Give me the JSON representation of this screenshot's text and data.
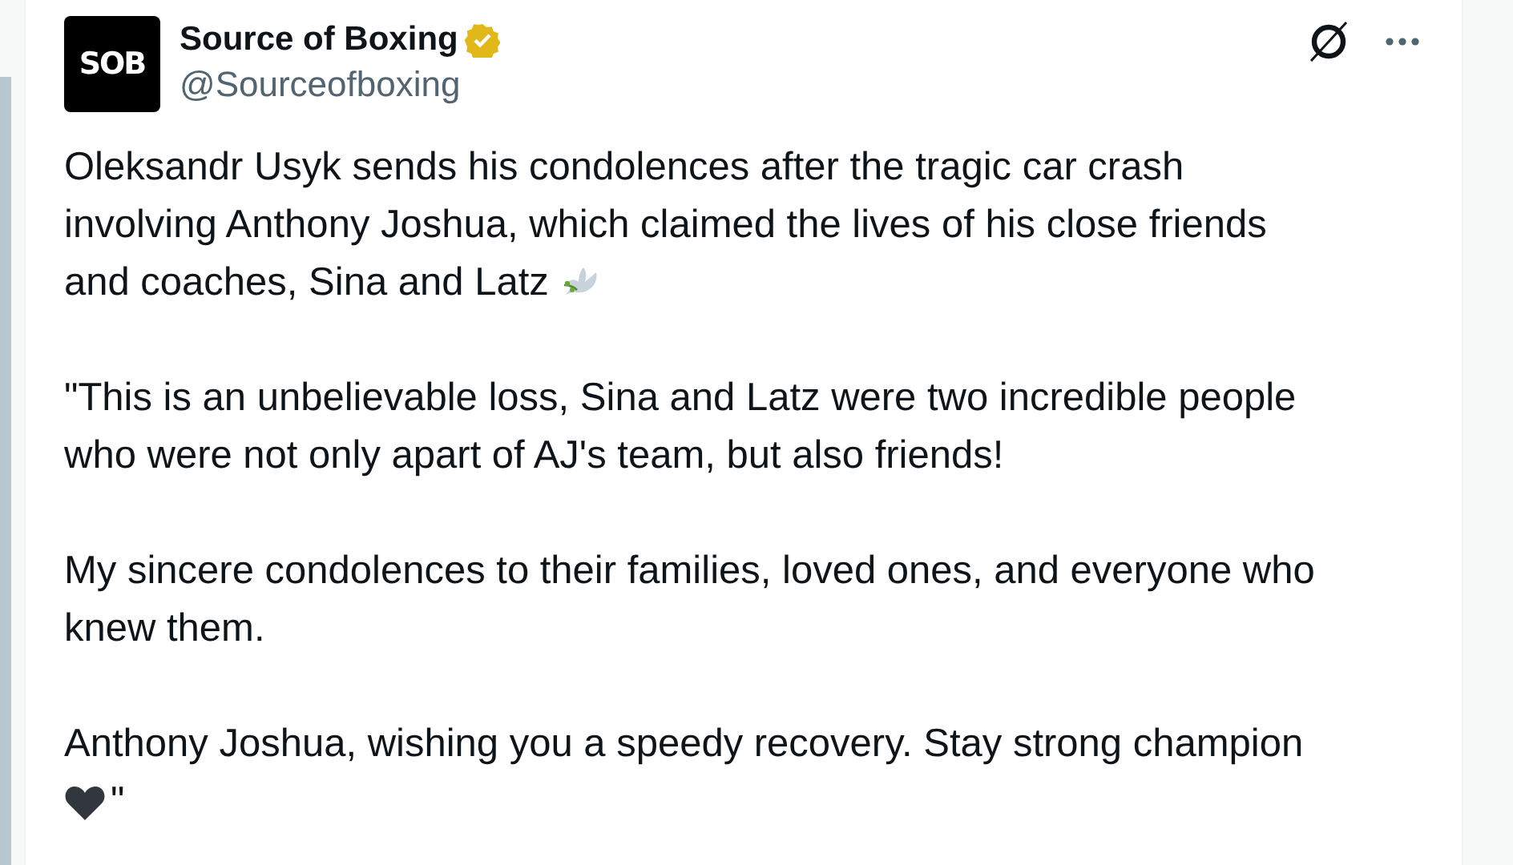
{
  "author": {
    "name": "Source of Boxing",
    "handle": "@Sourceofboxing",
    "avatar_text": "SOB",
    "verified": true
  },
  "paragraphs": [
    {
      "lines": [
        {
          "parts": [
            {
              "kind": "text",
              "text": "Oleksandr Usyk sends his condolences after the tragic car crash"
            }
          ]
        },
        {
          "parts": [
            {
              "kind": "text",
              "text": "involving Anthony Joshua, which claimed the lives of his close friends"
            }
          ]
        },
        {
          "parts": [
            {
              "kind": "text",
              "text": "and coaches, Sina and Latz"
            },
            {
              "kind": "dove"
            }
          ]
        }
      ]
    },
    {
      "lines": [
        {
          "parts": [
            {
              "kind": "text",
              "text": "\"This is an unbelievable loss, Sina and Latz were two incredible people"
            }
          ]
        },
        {
          "parts": [
            {
              "kind": "text",
              "text": "who were not only apart of AJ's team, but also friends!"
            }
          ]
        }
      ]
    },
    {
      "lines": [
        {
          "parts": [
            {
              "kind": "text",
              "text": "My sincere condolences to their families, loved ones, and everyone who"
            }
          ]
        },
        {
          "parts": [
            {
              "kind": "text",
              "text": "knew them."
            }
          ]
        }
      ]
    },
    {
      "lines": [
        {
          "parts": [
            {
              "kind": "text",
              "text": "Anthony Joshua, wishing you a speedy recovery. Stay strong champion"
            }
          ]
        },
        {
          "parts": [
            {
              "kind": "heart"
            },
            {
              "kind": "text",
              "text": "\""
            }
          ]
        }
      ]
    }
  ]
}
